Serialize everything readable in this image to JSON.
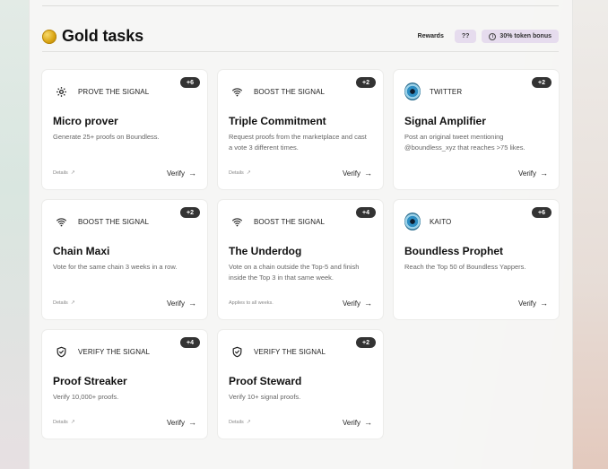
{
  "section": {
    "title": "Gold tasks",
    "rewards_label": "Rewards",
    "rewards_value": "??",
    "token_bonus": "30% token bonus"
  },
  "cards": [
    {
      "category": "PROVE THE SIGNAL",
      "icon": "gear-icon",
      "badge": "+6",
      "title": "Micro prover",
      "desc": "Generate 25+ proofs on Boundless.",
      "details": "Details",
      "verify": "Verify"
    },
    {
      "category": "BOOST THE SIGNAL",
      "icon": "signal-icon",
      "badge": "+2",
      "title": "Triple Commitment",
      "desc": "Request proofs from the marketplace and cast a vote 3 different times.",
      "details": "Details",
      "verify": "Verify"
    },
    {
      "category": "TWITTER",
      "icon": "avatar-icon",
      "badge": "+2",
      "title": "Signal Amplifier",
      "desc": "Post an original tweet mentioning @boundless_xyz that reaches >75 likes.",
      "details": "",
      "verify": "Verify"
    },
    {
      "category": "BOOST THE SIGNAL",
      "icon": "signal-icon",
      "badge": "+2",
      "title": "Chain Maxi",
      "desc": "Vote for the same chain 3 weeks in a row.",
      "details": "Details",
      "verify": "Verify"
    },
    {
      "category": "BOOST THE SIGNAL",
      "icon": "signal-icon",
      "badge": "+4",
      "title": "The Underdog",
      "desc": "Vote on a chain outside the Top-5 and finish inside the Top 3 in that same week.",
      "details": "Applies to all weeks.",
      "verify": "Verify"
    },
    {
      "category": "KAITO",
      "icon": "avatar-icon",
      "badge": "+6",
      "title": "Boundless Prophet",
      "desc": "Reach the Top 50 of Boundless Yappers.",
      "details": "",
      "verify": "Verify"
    },
    {
      "category": "VERIFY THE SIGNAL",
      "icon": "shield-check-icon",
      "badge": "+4",
      "title": "Proof Streaker",
      "desc": "Verify 10,000+ proofs.",
      "details": "Details",
      "verify": "Verify"
    },
    {
      "category": "VERIFY THE SIGNAL",
      "icon": "shield-check-icon",
      "badge": "+2",
      "title": "Proof Steward",
      "desc": "Verify 10+ signal proofs.",
      "details": "Details",
      "verify": "Verify"
    }
  ]
}
